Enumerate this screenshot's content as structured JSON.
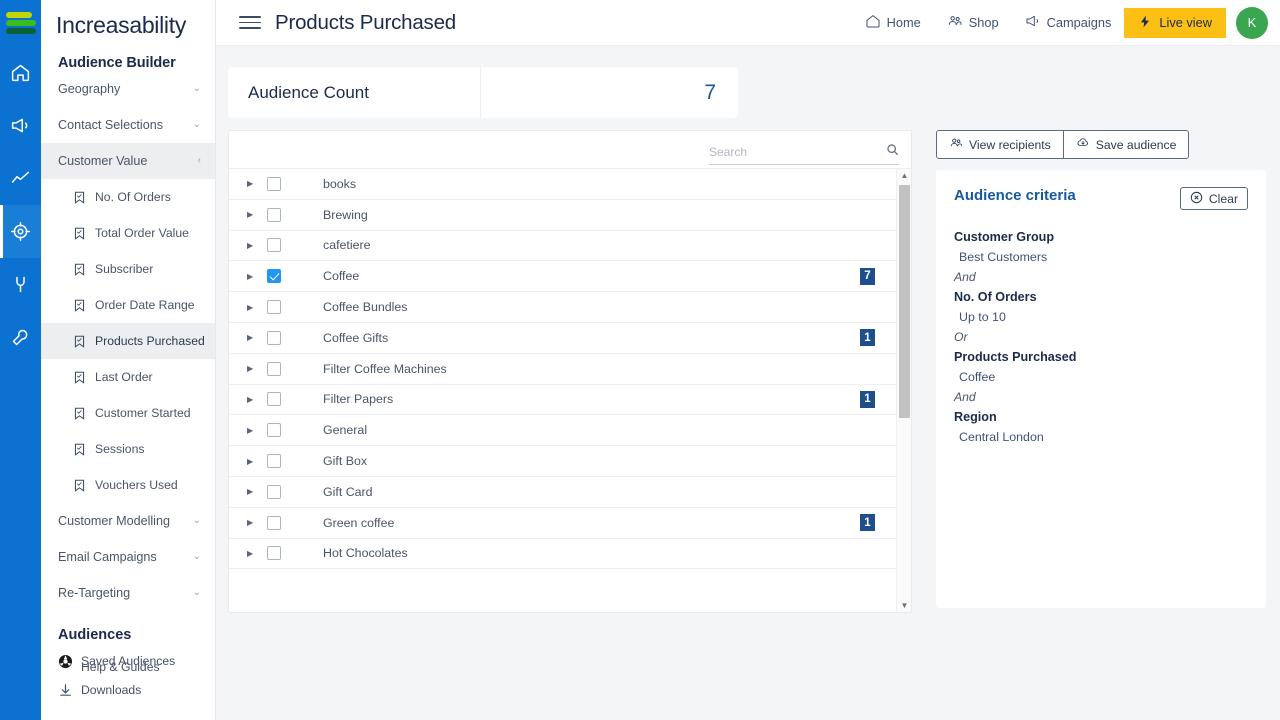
{
  "rail": {
    "logo_name": "increasability-logo",
    "items": [
      {
        "name": "home-icon",
        "label": "Home"
      },
      {
        "name": "megaphone-icon",
        "label": "Campaigns"
      },
      {
        "name": "analytics-icon",
        "label": "Analytics"
      },
      {
        "name": "target-icon",
        "label": "Audiences",
        "active": true
      },
      {
        "name": "plug-icon",
        "label": "Integrations"
      },
      {
        "name": "wrench-icon",
        "label": "Settings"
      }
    ]
  },
  "sidebar": {
    "brand": "Increasability",
    "section_title": "Audience Builder",
    "groups_top": [
      {
        "label": "Geography",
        "chevron": "⌄",
        "active": false
      },
      {
        "label": "Contact Selections",
        "chevron": "⌄",
        "active": false
      },
      {
        "label": "Customer Value",
        "chevron": "‹",
        "active": true
      }
    ],
    "sub_items": [
      {
        "label": "No. Of Orders",
        "active": false
      },
      {
        "label": "Total Order Value",
        "active": false
      },
      {
        "label": "Subscriber",
        "active": false
      },
      {
        "label": "Order Date Range",
        "active": false
      },
      {
        "label": "Products Purchased",
        "active": true
      },
      {
        "label": "Last Order",
        "active": false
      },
      {
        "label": "Customer Started",
        "active": false
      },
      {
        "label": "Sessions",
        "active": false
      },
      {
        "label": "Vouchers Used",
        "active": false
      }
    ],
    "groups_bottom": [
      {
        "label": "Customer Modelling",
        "chevron": "⌄"
      },
      {
        "label": "Email Campaigns",
        "chevron": "⌄"
      },
      {
        "label": "Re-Targeting",
        "chevron": "⌄"
      }
    ],
    "audiences_title": "Audiences",
    "overlap_items": [
      {
        "label": "Saved Audiences",
        "icon": "saved-audiences-icon"
      },
      {
        "label": "Help & Guides",
        "icon": "help-icon"
      }
    ],
    "cut_item": {
      "label": "Downloads",
      "icon": "download-icon"
    }
  },
  "topbar": {
    "menu_icon": "hamburger-icon",
    "title": "Products Purchased",
    "links": [
      {
        "label": "Home",
        "icon": "home-icon"
      },
      {
        "label": "Shop",
        "icon": "shop-icon"
      },
      {
        "label": "Campaigns",
        "icon": "megaphone-icon"
      }
    ],
    "live_view": {
      "label": "Live view",
      "icon": "bolt-icon",
      "color": "#fcc015"
    },
    "avatar": {
      "initial": "K",
      "color": "#3ba650"
    }
  },
  "audience_count": {
    "label": "Audience Count",
    "value": "7"
  },
  "list": {
    "search_placeholder": "Search",
    "search_value": "",
    "rows": [
      {
        "label": "books",
        "checked": false,
        "badge": ""
      },
      {
        "label": "Brewing",
        "checked": false,
        "badge": ""
      },
      {
        "label": "cafetiere",
        "checked": false,
        "badge": ""
      },
      {
        "label": "Coffee",
        "checked": true,
        "badge": "7"
      },
      {
        "label": "Coffee Bundles",
        "checked": false,
        "badge": ""
      },
      {
        "label": "Coffee Gifts",
        "checked": false,
        "badge": "1"
      },
      {
        "label": "Filter Coffee Machines",
        "checked": false,
        "badge": ""
      },
      {
        "label": "Filter Papers",
        "checked": false,
        "badge": "1"
      },
      {
        "label": "General",
        "checked": false,
        "badge": ""
      },
      {
        "label": "Gift Box",
        "checked": false,
        "badge": ""
      },
      {
        "label": "Gift Card",
        "checked": false,
        "badge": ""
      },
      {
        "label": "Green coffee",
        "checked": false,
        "badge": "1"
      },
      {
        "label": "Hot Chocolates",
        "checked": false,
        "badge": ""
      }
    ]
  },
  "right_panel": {
    "buttons": [
      {
        "label": "View recipients",
        "icon": "people-icon"
      },
      {
        "label": "Save audience",
        "icon": "save-cloud-icon"
      }
    ],
    "criteria_title": "Audience criteria",
    "clear_label": "Clear",
    "criteria": [
      {
        "kind": "field",
        "text": "Customer Group"
      },
      {
        "kind": "value",
        "text": "Best Customers"
      },
      {
        "kind": "op",
        "text": "And"
      },
      {
        "kind": "field",
        "text": "No. Of Orders"
      },
      {
        "kind": "value",
        "text": "Up to 10"
      },
      {
        "kind": "op",
        "text": "Or"
      },
      {
        "kind": "field",
        "text": "Products Purchased"
      },
      {
        "kind": "value",
        "text": "Coffee"
      },
      {
        "kind": "op",
        "text": "And"
      },
      {
        "kind": "field",
        "text": "Region"
      },
      {
        "kind": "value",
        "text": "Central London"
      }
    ]
  }
}
